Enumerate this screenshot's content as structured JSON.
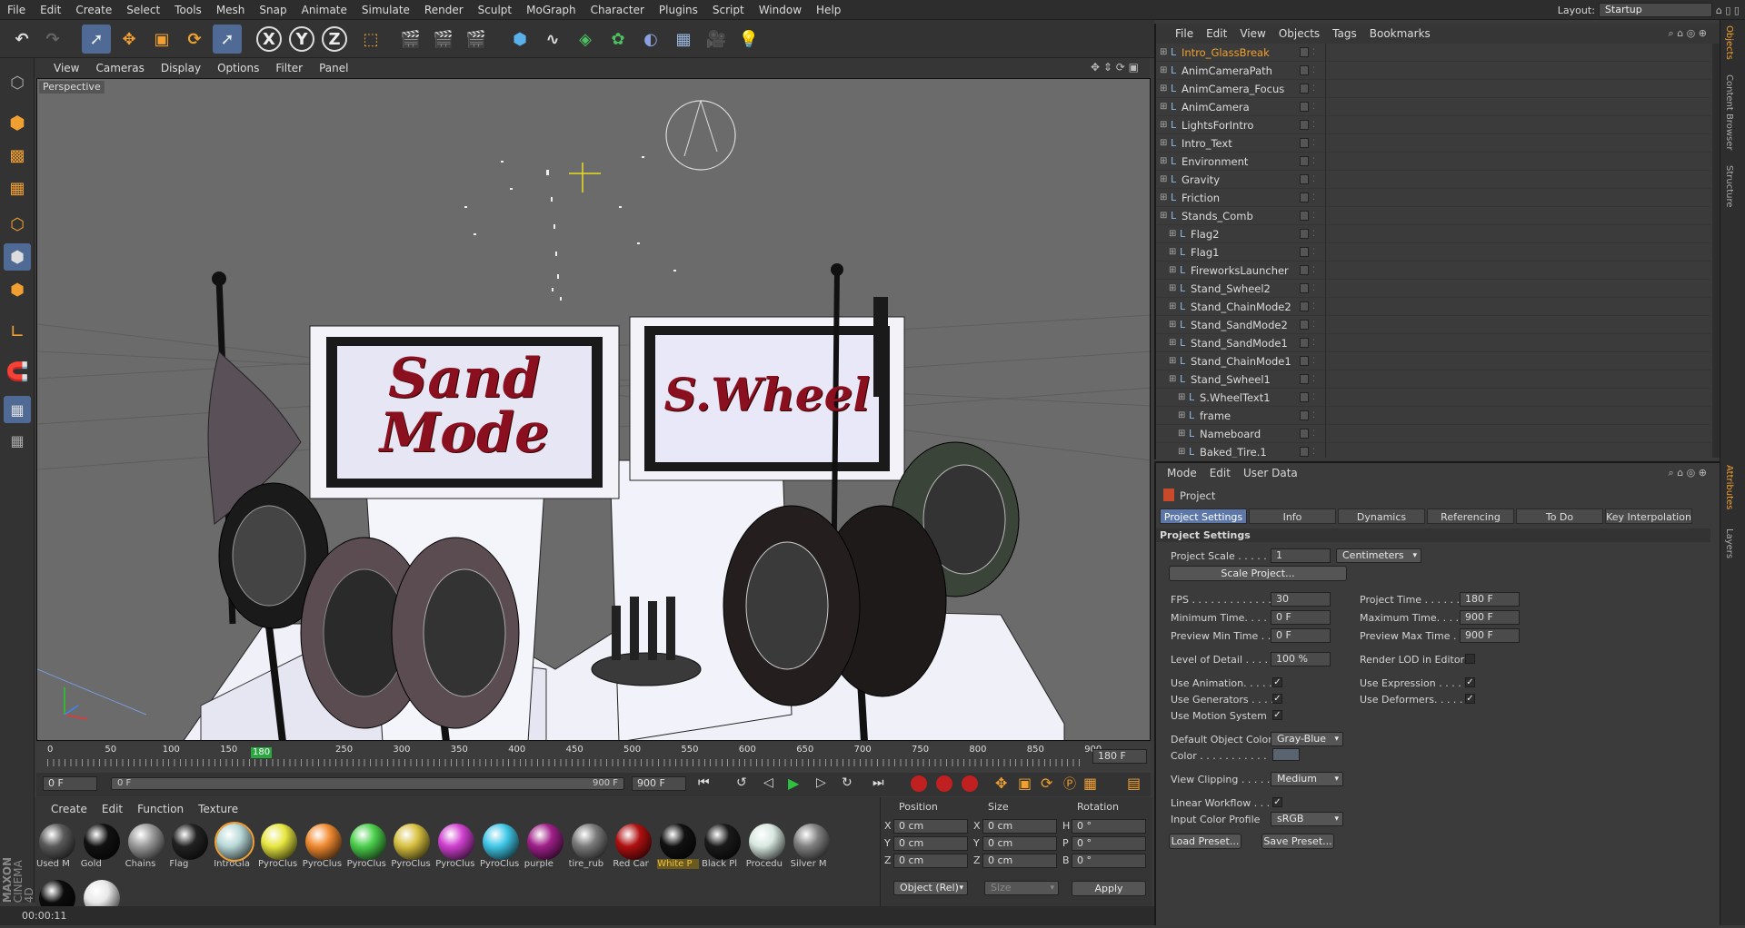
{
  "menubar": {
    "items": [
      "File",
      "Edit",
      "Create",
      "Select",
      "Tools",
      "Mesh",
      "Snap",
      "Animate",
      "Simulate",
      "Render",
      "Sculpt",
      "MoGraph",
      "Character",
      "Plugins",
      "Script",
      "Window",
      "Help"
    ],
    "layout_label": "Layout:",
    "layout_value": "Startup"
  },
  "toolbar": {
    "axis_x": "X",
    "axis_y": "Y",
    "axis_z": "Z"
  },
  "viewport": {
    "menu": [
      "View",
      "Cameras",
      "Display",
      "Options",
      "Filter",
      "Panel"
    ],
    "label": "Perspective",
    "sign_left_line1": "Sand",
    "sign_left_line2": "Mode",
    "sign_right": "S.Wheel"
  },
  "timeline": {
    "ticks": [
      "0",
      "50",
      "100",
      "150",
      "180",
      "250",
      "300",
      "350",
      "400",
      "450",
      "500",
      "550",
      "600",
      "650",
      "700",
      "750",
      "800",
      "850",
      "900"
    ],
    "current_frame": "180",
    "end_frame_field": "180 F",
    "start_field": "0 F",
    "range_start": "0 F",
    "range_end": "900 F",
    "max_field": "900 F"
  },
  "materials": {
    "menu": [
      "Create",
      "Edit",
      "Function",
      "Texture"
    ],
    "items": [
      {
        "name": "Used M",
        "color": "#5a5a5a"
      },
      {
        "name": "Gold",
        "color": "#111111"
      },
      {
        "name": "Chains",
        "color": "#9a9a9a"
      },
      {
        "name": "Flag",
        "color": "#222222"
      },
      {
        "name": "IntroGla",
        "color": "#b8d8d8"
      },
      {
        "name": "PyroClus",
        "color": "#e6e640"
      },
      {
        "name": "PyroClus",
        "color": "#f08a30"
      },
      {
        "name": "PyroClus",
        "color": "#4cd04c"
      },
      {
        "name": "PyroClus",
        "color": "#d8c040"
      },
      {
        "name": "PyroClus",
        "color": "#d040d0"
      },
      {
        "name": "PyroClus",
        "color": "#40c8e8"
      },
      {
        "name": "purple",
        "color": "#a0208a"
      },
      {
        "name": "tire_rub",
        "color": "#7a7a7a"
      },
      {
        "name": "Red Car",
        "color": "#b01010"
      },
      {
        "name": "White P",
        "color": "#111111"
      },
      {
        "name": "Black Pl",
        "color": "#1a1a1a"
      },
      {
        "name": "Procedu",
        "color": "#d8e8e0"
      },
      {
        "name": "Silver M",
        "color": "#808080"
      },
      {
        "name": "",
        "color": "#0c0c0c"
      },
      {
        "name": "",
        "color": "#e8e8e8"
      }
    ]
  },
  "coords": {
    "headers": [
      "Position",
      "Size",
      "Rotation"
    ],
    "rows": [
      {
        "a": "X",
        "av": "0 cm",
        "b": "X",
        "bv": "0 cm",
        "c": "H",
        "cv": "0 °"
      },
      {
        "a": "Y",
        "av": "0 cm",
        "b": "Y",
        "bv": "0 cm",
        "c": "P",
        "cv": "0 °"
      },
      {
        "a": "Z",
        "av": "0 cm",
        "b": "Z",
        "bv": "0 cm",
        "c": "B",
        "cv": "0 °"
      }
    ],
    "mode": "Object (Rel)",
    "size_mode": "Size",
    "apply": "Apply"
  },
  "status": "00:00:11",
  "objects": {
    "menu": [
      "File",
      "Edit",
      "View",
      "Objects",
      "Tags",
      "Bookmarks"
    ],
    "rows": [
      {
        "name": "Intro_GlassBreak",
        "indent": 0,
        "highlight": true
      },
      {
        "name": "AnimCameraPath",
        "indent": 0
      },
      {
        "name": "AnimCamera_Focus",
        "indent": 0
      },
      {
        "name": "AnimCamera",
        "indent": 0
      },
      {
        "name": "LightsForIntro",
        "indent": 0
      },
      {
        "name": "Intro_Text",
        "indent": 0
      },
      {
        "name": "Environment",
        "indent": 0
      },
      {
        "name": "Gravity",
        "indent": 0
      },
      {
        "name": "Friction",
        "indent": 0
      },
      {
        "name": "Stands_Comb",
        "indent": 0
      },
      {
        "name": "Flag2",
        "indent": 1
      },
      {
        "name": "Flag1",
        "indent": 1
      },
      {
        "name": "FireworksLauncher",
        "indent": 1
      },
      {
        "name": "Stand_Swheel2",
        "indent": 1
      },
      {
        "name": "Stand_ChainMode2",
        "indent": 1
      },
      {
        "name": "Stand_SandMode2",
        "indent": 1
      },
      {
        "name": "Stand_SandMode1",
        "indent": 1
      },
      {
        "name": "Stand_ChainMode1",
        "indent": 1
      },
      {
        "name": "Stand_Swheel1",
        "indent": 1
      },
      {
        "name": "S.WheelText1",
        "indent": 2
      },
      {
        "name": "frame",
        "indent": 2
      },
      {
        "name": "Nameboard",
        "indent": 2
      },
      {
        "name": "Baked_Tire.1",
        "indent": 2
      }
    ]
  },
  "attributes": {
    "menu": [
      "Mode",
      "Edit",
      "User Data"
    ],
    "title": "Project",
    "tabs": [
      "Project Settings",
      "Info",
      "Dynamics",
      "Referencing",
      "To Do",
      "Key Interpolation"
    ],
    "section": "Project Settings",
    "project_scale_label": "Project Scale . . . . . .",
    "project_scale_value": "1",
    "project_scale_unit": "Centimeters",
    "scale_project_btn": "Scale Project...",
    "fps_label": "FPS . . . . . . . . . . . . .",
    "fps": "30",
    "project_time_label": "Project Time . . . . . . .",
    "project_time": "180 F",
    "min_time_label": "Minimum Time. . . . .",
    "min_time": "0 F",
    "max_time_label": "Maximum Time. . . . .",
    "max_time": "900 F",
    "prev_min_label": "Preview Min Time . .",
    "prev_min": "0 F",
    "prev_max_label": "Preview Max Time . .",
    "prev_max": "900 F",
    "lod_label": "Level of Detail . . . . .",
    "lod": "100 %",
    "render_lod_label": "Render LOD in Editor",
    "use_anim_label": "Use Animation. . . . .",
    "use_expr_label": "Use Expression . . . . .",
    "use_gen_label": "Use Generators . . . .",
    "use_def_label": "Use Deformers. . . . . .",
    "use_motion_label": "Use Motion System",
    "default_color_label": "Default Object Color",
    "default_color": "Gray-Blue",
    "color_label": "Color . . . . . . . . . . .",
    "view_clip_label": "View Clipping . . . . .",
    "view_clip": "Medium",
    "linear_label": "Linear Workflow . . .",
    "input_profile_label": "Input Color Profile",
    "input_profile": "sRGB",
    "load_preset": "Load Preset...",
    "save_preset": "Save Preset..."
  },
  "right_tabs": [
    "Objects",
    "Content Browser",
    "Structure",
    "Attributes",
    "Layers"
  ],
  "brand": {
    "line1": "MAXON",
    "line2": "CINEMA 4D"
  },
  "colors": {
    "accent": "#5d78a8",
    "highlight_text": "#f0a030",
    "sign_text": "#8a1020"
  }
}
